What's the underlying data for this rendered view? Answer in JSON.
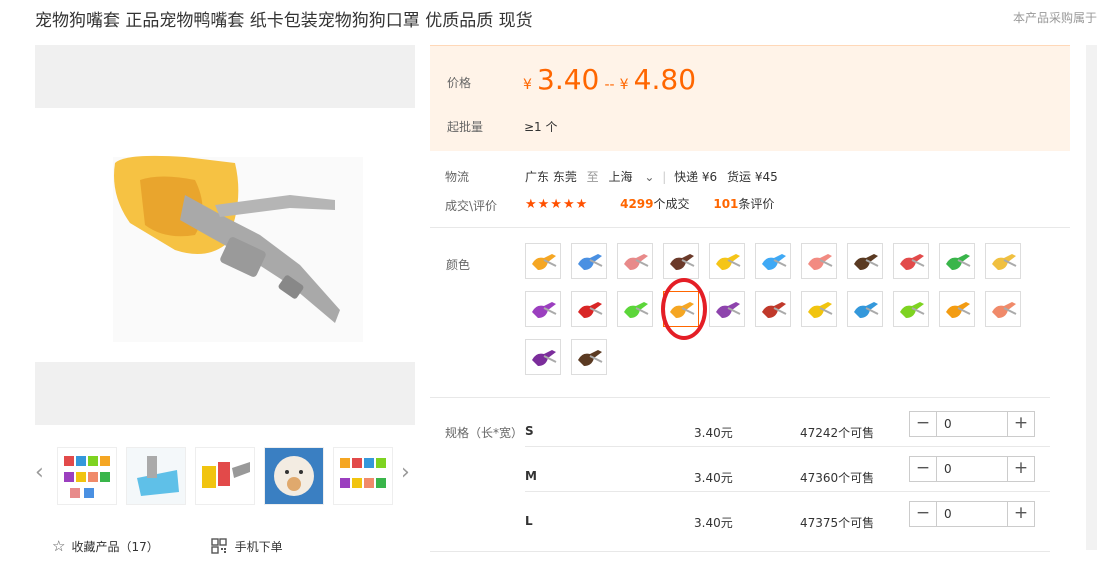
{
  "title": "宠物狗嘴套 正品宠物鸭嘴套 纸卡包装宠物狗狗口罩 优质品质 现货",
  "notice": "本产品采购属于",
  "price": {
    "label": "价格",
    "currency": "¥",
    "min": "3.40",
    "separator": "--",
    "max": "4.80"
  },
  "moq": {
    "label": "起批量",
    "value": "≥1 个"
  },
  "logistics": {
    "label": "物流",
    "from": "广东 东莞",
    "to_word": "至",
    "to": "上海",
    "express": "快递 ¥6",
    "freight": "货运 ¥45"
  },
  "deals": {
    "label": "成交\\评价",
    "stars": "★★★★★",
    "count": "4299",
    "count_suffix": "个成交",
    "reviews": "101",
    "reviews_suffix": "条评价"
  },
  "color": {
    "label": "颜色",
    "swatches": [
      {
        "c": "#f5a623"
      },
      {
        "c": "#4a90e2"
      },
      {
        "c": "#e88a8a"
      },
      {
        "c": "#6b3a2a"
      },
      {
        "c": "#f5c518"
      },
      {
        "c": "#3fa9f5"
      },
      {
        "c": "#f28b82"
      },
      {
        "c": "#5a3a22"
      },
      {
        "c": "#e24a4a"
      },
      {
        "c": "#39b54a"
      },
      {
        "c": "#f0c040"
      },
      {
        "c": "#9b3fbf"
      },
      {
        "c": "#d92626"
      },
      {
        "c": "#5cd63a"
      },
      {
        "c": "#f5a623"
      },
      {
        "c": "#8e44ad"
      },
      {
        "c": "#c0392b"
      },
      {
        "c": "#f1c40f"
      },
      {
        "c": "#3498db"
      },
      {
        "c": "#7ed321"
      },
      {
        "c": "#f39c12"
      },
      {
        "c": "#f08a6a"
      },
      {
        "c": "#7b2d9b"
      },
      {
        "c": "#5b3a22"
      }
    ],
    "selected_index": 14
  },
  "specs": {
    "label": "规格（长*宽）",
    "rows": [
      {
        "sku": "S",
        "price": "3.40元",
        "stock": "47242个可售",
        "qty": "0"
      },
      {
        "sku": "M",
        "price": "3.40元",
        "stock": "47360个可售",
        "qty": "0"
      },
      {
        "sku": "L",
        "price": "3.40元",
        "stock": "47375个可售",
        "qty": "0"
      }
    ]
  },
  "actions": {
    "favorite": "收藏产品（17）",
    "mobile": "手机下单"
  }
}
